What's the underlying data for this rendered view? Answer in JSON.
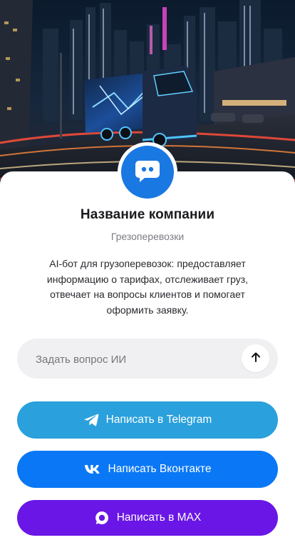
{
  "company": {
    "name": "Название компании",
    "category": "Грезоперевозки",
    "description": "AI-бот для грузоперевозок: предоставляет информацию о тарифах, отслеживает груз, отвечает на вопросы клиентов и помогает оформить заявку."
  },
  "ask": {
    "placeholder": "Задать вопрос ИИ",
    "send_icon": "arrow-up-icon"
  },
  "actions": {
    "telegram_label": "Написать в Telegram",
    "vk_label": "Написать Вконтакте",
    "max_label": "Написать в MAX"
  },
  "colors": {
    "avatar": "#1a78e2",
    "telegram": "#2aa0dc",
    "vk": "#0a78f6",
    "max": "#6a16e6",
    "input_bg": "#f0f0f2"
  },
  "icons": {
    "avatar": "chat-bot-icon",
    "telegram": "telegram-icon",
    "vk": "vk-icon",
    "max": "max-icon"
  }
}
